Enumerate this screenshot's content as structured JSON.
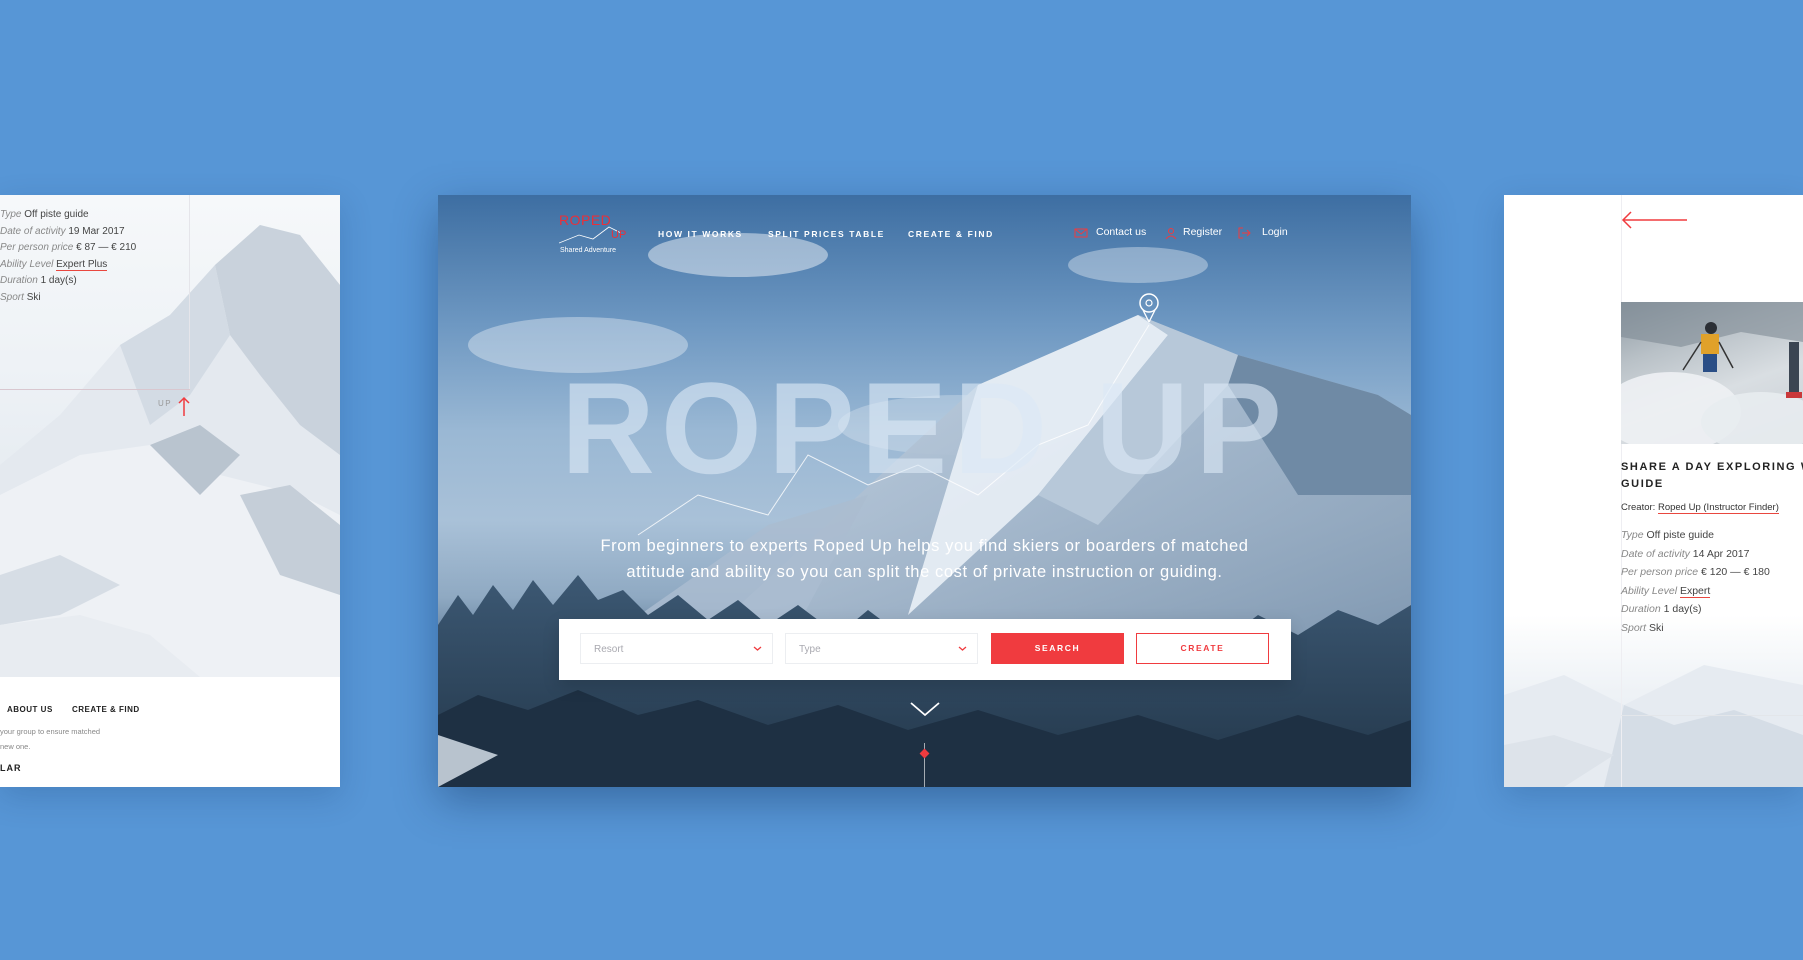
{
  "left_panel": {
    "details": [
      {
        "key": "Type",
        "value": "Off piste guide"
      },
      {
        "key": "Date of activity",
        "value": "19 Mar 2017"
      },
      {
        "key": "Per person price",
        "value": "€ 87 — € 210"
      },
      {
        "key": "Ability Level",
        "value": "Expert Plus"
      },
      {
        "key": "Duration",
        "value": "1 day(s)"
      },
      {
        "key": "Sport",
        "value": "Ski"
      }
    ],
    "up_label": "UP",
    "footer": {
      "nav_about": "ABOUT US",
      "nav_create": "CREATE & FIND",
      "line1": "your group to ensure matched",
      "line2": "new one.",
      "heading_fragment": "LAR"
    }
  },
  "hero": {
    "logo": {
      "line1": "ROPED",
      "line2": "UP",
      "tagline": "Shared Adventure"
    },
    "nav": [
      "HOW IT WORKS",
      "SPLIT PRICES TABLE",
      "CREATE & FIND"
    ],
    "top_links": {
      "contact": "Contact us",
      "register": "Register",
      "login": "Login"
    },
    "title": "ROPED UP",
    "subtitle": "From beginners to experts Roped Up helps you find skiers or boarders of matched attitude and ability so you can split the cost of private instruction or guiding.",
    "search": {
      "resort_placeholder": "Resort",
      "type_placeholder": "Type",
      "search_label": "SEARCH",
      "create_label": "CREATE"
    },
    "accent_color": "#f03b3f"
  },
  "right_panel": {
    "title_line1": "SHARE A DAY EXPLORING WI",
    "title_line2": "GUIDE",
    "creator_label": "Creator:",
    "creator_value": "Roped Up (Instructor Finder)",
    "details": [
      {
        "key": "Type",
        "value": "Off piste guide"
      },
      {
        "key": "Date of activity",
        "value": "14 Apr 2017"
      },
      {
        "key": "Per person price",
        "value": "€ 120 — € 180"
      },
      {
        "key": "Ability Level",
        "value": "Expert"
      },
      {
        "key": "Duration",
        "value": "1 day(s)"
      },
      {
        "key": "Sport",
        "value": "Ski"
      }
    ]
  }
}
